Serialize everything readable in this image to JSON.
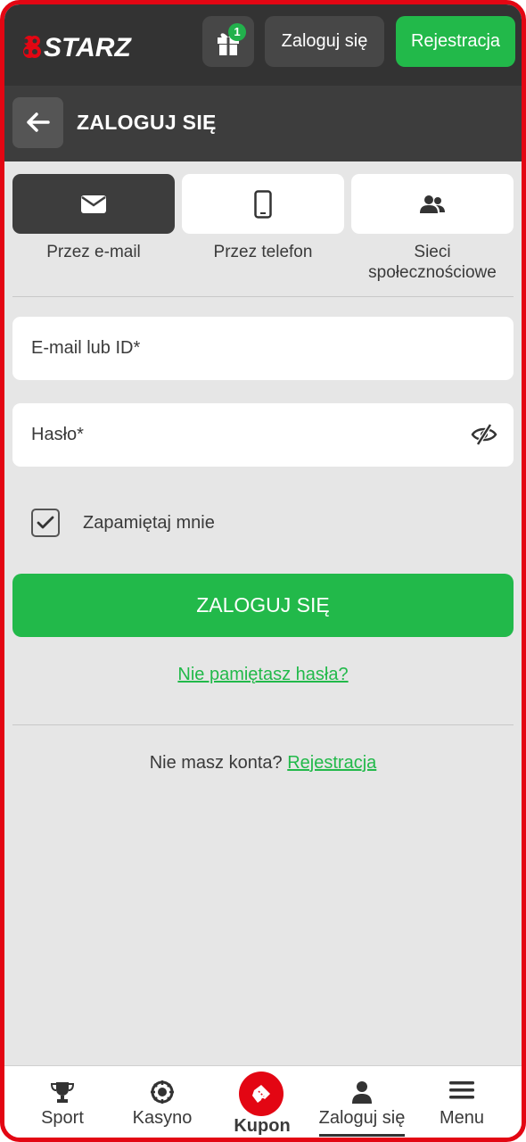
{
  "header": {
    "logo_text": "888STARZ",
    "gift_badge": "1",
    "login_label": "Zaloguj się",
    "register_label": "Rejestracja"
  },
  "subheader": {
    "title": "ZALOGUJ SIĘ"
  },
  "tabs": [
    {
      "label": "Przez e-mail",
      "icon": "envelope-icon",
      "active": true
    },
    {
      "label": "Przez telefon",
      "icon": "phone-icon",
      "active": false
    },
    {
      "label": "Sieci społecznościowe",
      "icon": "users-icon",
      "active": false
    }
  ],
  "form": {
    "email_placeholder": "E-mail lub ID*",
    "password_placeholder": "Hasło*",
    "remember_label": "Zapamiętaj mnie",
    "remember_checked": true,
    "submit_label": "ZALOGUJ SIĘ",
    "forgot_label": "Nie pamiętasz hasła?",
    "no_account_text": "Nie masz konta?",
    "register_link": "Rejestracja"
  },
  "bottom_nav": [
    {
      "label": "Sport",
      "icon": "trophy-icon"
    },
    {
      "label": "Kasyno",
      "icon": "casino-chip-icon"
    },
    {
      "label": "Kupon",
      "icon": "ticket-icon"
    },
    {
      "label": "Zaloguj się",
      "icon": "user-icon",
      "active": true
    },
    {
      "label": "Menu",
      "icon": "menu-icon"
    }
  ],
  "colors": {
    "brand_red": "#e30613",
    "accent_green": "#22b94a",
    "dark_bar": "#333333"
  }
}
